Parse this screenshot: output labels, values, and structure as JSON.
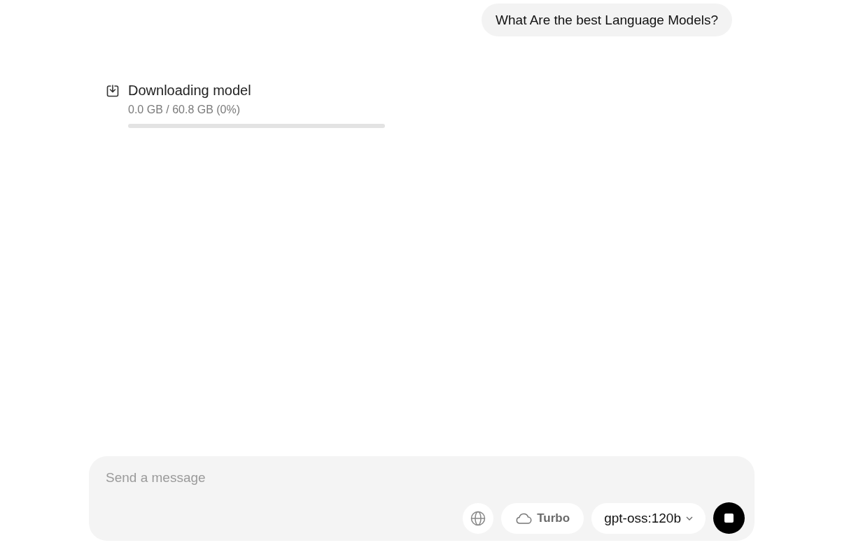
{
  "user_message": "What Are the best Language Models?",
  "download": {
    "title": "Downloading model",
    "progress_text": "0.0 GB / 60.8 GB (0%)",
    "level": 0
  },
  "composer": {
    "placeholder": "Send a message",
    "turbo_label": "Turbo",
    "model": "gpt-oss:120b"
  }
}
